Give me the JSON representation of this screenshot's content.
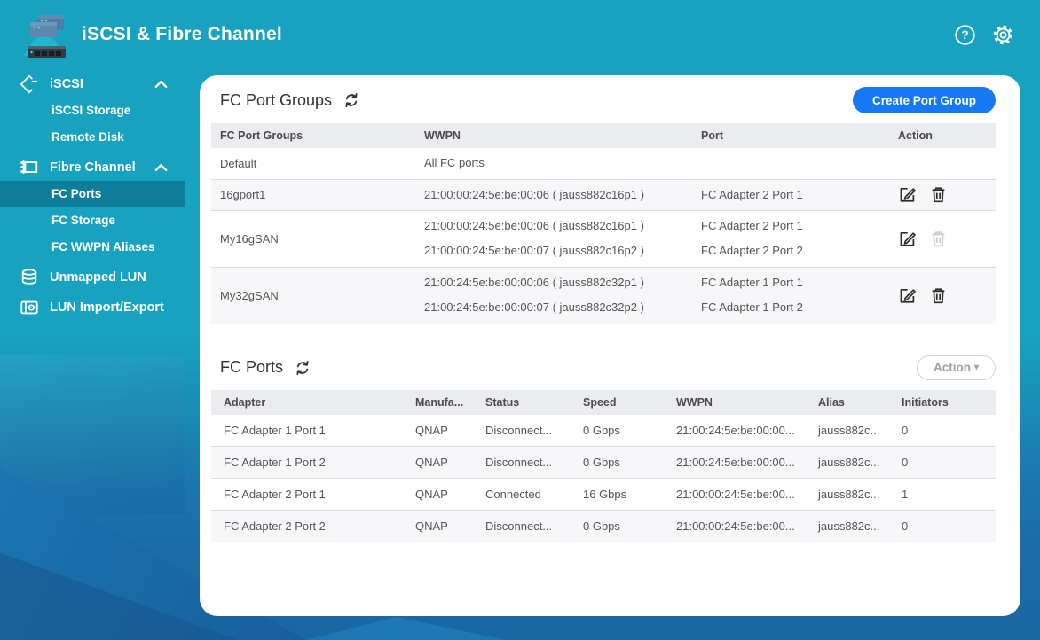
{
  "header": {
    "title": "iSCSI & Fibre Channel"
  },
  "sidebar": {
    "items": [
      {
        "label": "iSCSI",
        "icon": "iscsi-icon",
        "expanded": true,
        "children": [
          {
            "label": "iSCSI Storage",
            "selected": false
          },
          {
            "label": "Remote Disk",
            "selected": false
          }
        ]
      },
      {
        "label": "Fibre Channel",
        "icon": "fibre-channel-icon",
        "expanded": true,
        "children": [
          {
            "label": "FC Ports",
            "selected": true
          },
          {
            "label": "FC Storage",
            "selected": false
          },
          {
            "label": "FC WWPN Aliases",
            "selected": false
          }
        ]
      },
      {
        "label": "Unmapped LUN",
        "icon": "unmapped-lun-icon",
        "children": []
      },
      {
        "label": "LUN Import/Export",
        "icon": "lun-import-export-icon",
        "children": []
      }
    ]
  },
  "port_groups_section": {
    "title": "FC Port Groups",
    "create_button_label": "Create Port Group",
    "columns": [
      "FC Port Groups",
      "WWPN",
      "Port",
      "Action"
    ],
    "rows": [
      {
        "name": "Default",
        "wwpn_lines": [
          "All FC ports"
        ],
        "port_lines": [],
        "has_actions": false,
        "delete_enabled": false
      },
      {
        "name": "16gport1",
        "wwpn_lines": [
          "21:00:00:24:5e:be:00:06 ( jauss882c16p1 )"
        ],
        "port_lines": [
          "FC Adapter 2 Port 1"
        ],
        "has_actions": true,
        "delete_enabled": true
      },
      {
        "name": "My16gSAN",
        "wwpn_lines": [
          "21:00:00:24:5e:be:00:06 ( jauss882c16p1 )",
          "21:00:00:24:5e:be:00:07 ( jauss882c16p2 )"
        ],
        "port_lines": [
          "FC Adapter 2 Port 1",
          "FC Adapter 2 Port 2"
        ],
        "has_actions": true,
        "delete_enabled": false
      },
      {
        "name": "My32gSAN",
        "wwpn_lines": [
          "21:00:24:5e:be:00:00:06 ( jauss882c32p1 )",
          "21:00:24:5e:be:00:00:07 ( jauss882c32p2 )"
        ],
        "port_lines": [
          "FC Adapter 1 Port 1",
          "FC Adapter 1 Port 2"
        ],
        "has_actions": true,
        "delete_enabled": true
      }
    ]
  },
  "fc_ports_section": {
    "title": "FC Ports",
    "action_button_label": "Action",
    "action_button_enabled": false,
    "columns": [
      "Adapter",
      "Manufa...",
      "Status",
      "Speed",
      "WWPN",
      "Alias",
      "Initiators"
    ],
    "rows": [
      {
        "adapter": "FC Adapter 1 Port 1",
        "manufacturer": "QNAP",
        "status": "Disconnect...",
        "speed": "0 Gbps",
        "wwpn": "21:00:24:5e:be:00:00...",
        "alias": "jauss882c...",
        "initiators": "0"
      },
      {
        "adapter": "FC Adapter 1 Port 2",
        "manufacturer": "QNAP",
        "status": "Disconnect...",
        "speed": "0 Gbps",
        "wwpn": "21:00:24:5e:be:00:00...",
        "alias": "jauss882c...",
        "initiators": "0"
      },
      {
        "adapter": "FC Adapter 2 Port 1",
        "manufacturer": "QNAP",
        "status": "Connected",
        "speed": "16 Gbps",
        "wwpn": "21:00:00:24:5e:be:00...",
        "alias": "jauss882c...",
        "initiators": "1"
      },
      {
        "adapter": "FC Adapter 2 Port 2",
        "manufacturer": "QNAP",
        "status": "Disconnect...",
        "speed": "0 Gbps",
        "wwpn": "21:00:00:24:5e:be:00...",
        "alias": "jauss882c...",
        "initiators": "0"
      }
    ]
  },
  "colors": {
    "header_teal": "#17A3BF",
    "sidebar_selected": "#0D7D9A",
    "primary_button_blue": "#1678F5",
    "background_blue_bottom": "#1B6CA7",
    "table_header_bg": "#EBECF0",
    "row_stripe": "#F7F7F9"
  }
}
